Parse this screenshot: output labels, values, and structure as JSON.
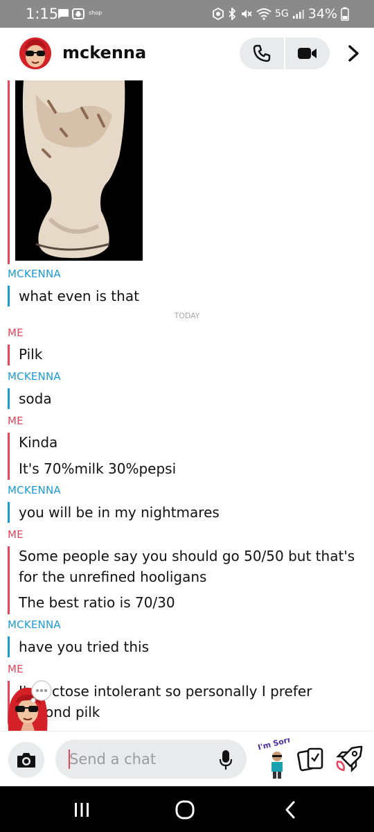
{
  "status_bar": {
    "time": "1:15",
    "shop_label": "shop",
    "network": "5G",
    "battery": "34%",
    "icons": [
      "message-icon",
      "snapchat-ghost-icon",
      "shop-icon",
      "data-saver-icon",
      "bluetooth-icon",
      "mute-icon",
      "wifi-icon",
      "signal-icon",
      "battery-icon"
    ]
  },
  "header": {
    "contact_name": "mckenna",
    "icons": [
      "avatar",
      "phone-icon",
      "video-camera-icon",
      "chevron-right-icon"
    ]
  },
  "chat": {
    "snap_image": {
      "description_icon": "photo-icon"
    },
    "day_separator": "TODAY",
    "messages": [
      {
        "sender": "MCKENNA",
        "from": "them",
        "texts": [
          "what even is that"
        ]
      },
      {
        "sender": "ME",
        "from": "me",
        "texts": [
          "Pilk"
        ]
      },
      {
        "sender": "MCKENNA",
        "from": "them",
        "texts": [
          "soda"
        ]
      },
      {
        "sender": "ME",
        "from": "me",
        "texts": [
          "Kinda",
          "It's 70%milk 30%pepsi"
        ]
      },
      {
        "sender": "MCKENNA",
        "from": "them",
        "texts": [
          "you will be in my nightmares"
        ]
      },
      {
        "sender": "ME",
        "from": "me",
        "texts": [
          "Some people say you should go 50/50 but that's",
          "for the unrefined hooligans",
          "The best ratio is 70/30"
        ]
      },
      {
        "sender": "MCKENNA",
        "from": "them",
        "texts": [
          "have you tried this"
        ]
      },
      {
        "sender": "ME",
        "from": "me",
        "texts": [
          "I'm lactose intolerant so personally I prefer",
          "almond pilk"
        ]
      }
    ],
    "visible_partial_texts": [
      "I'",
      "ctose intolerant so personally I prefer",
      "ond pilk"
    ]
  },
  "input_bar": {
    "placeholder": "Send a chat",
    "sticker_text": "I'm Sorry",
    "icons": [
      "camera-icon",
      "microphone-icon",
      "bitmoji-sticker-icon",
      "cards-icon",
      "rocket-icon"
    ]
  },
  "nav_bar": {
    "icons": [
      "recent-apps-icon",
      "home-icon",
      "back-icon"
    ]
  },
  "colors": {
    "me": "#e8445a",
    "them": "#1a9bd7",
    "status_bar": "#8a8a8a",
    "pill": "#e9eaec"
  }
}
